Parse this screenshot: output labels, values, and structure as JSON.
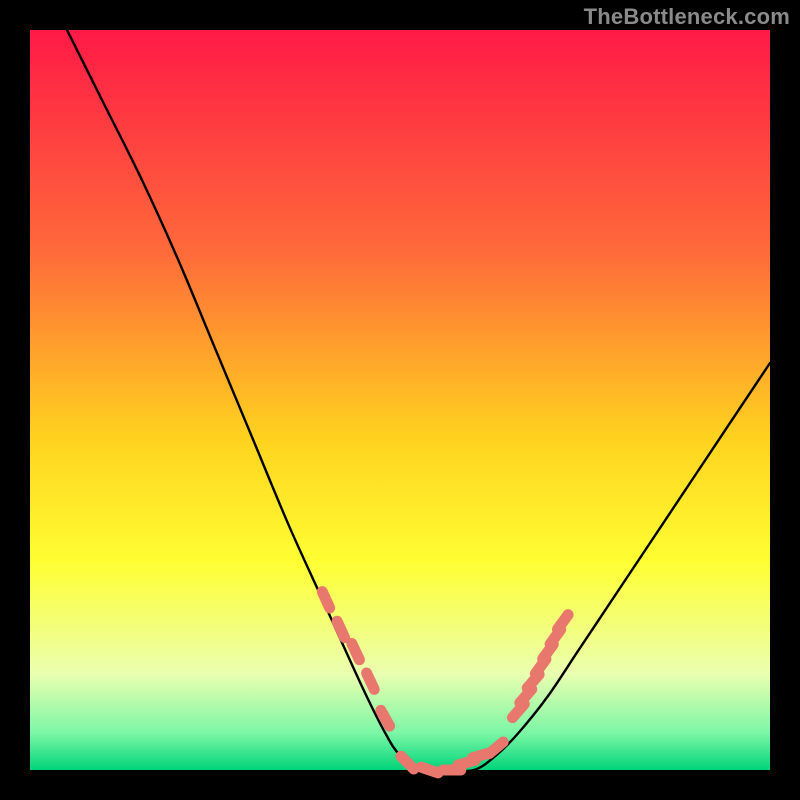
{
  "watermark": "TheBottleneck.com",
  "colors": {
    "frame": "#000000",
    "grad_top": "#ff1a46",
    "grad_mid1": "#ff6a3a",
    "grad_mid2": "#ffd21f",
    "grad_mid3": "#ffff33",
    "grad_mid4": "#eaffb0",
    "grad_bottom1": "#7cf7a6",
    "grad_bottom2": "#00d47a",
    "curve": "#000000",
    "marker": "#e8776e"
  },
  "chart_data": {
    "type": "line",
    "title": "",
    "xlabel": "",
    "ylabel": "",
    "xlim": [
      0,
      100
    ],
    "ylim": [
      0,
      100
    ],
    "grid": false,
    "legend": false,
    "series": [
      {
        "name": "bottleneck-curve",
        "x": [
          5,
          10,
          15,
          20,
          25,
          30,
          35,
          40,
          45,
          48,
          50,
          53,
          56,
          60,
          63,
          66,
          70,
          74,
          78,
          82,
          86,
          90,
          94,
          98,
          100
        ],
        "y": [
          100,
          90,
          80,
          69,
          57,
          45,
          33,
          22,
          11,
          5,
          2,
          0,
          0,
          0,
          2,
          5,
          10,
          16,
          22,
          28,
          34,
          40,
          46,
          52,
          55
        ]
      }
    ],
    "markers": [
      {
        "name": "left-cluster",
        "x": [
          40,
          42,
          44,
          46,
          48
        ],
        "y": [
          23,
          19,
          16,
          12,
          7
        ]
      },
      {
        "name": "floor-cluster",
        "x": [
          51,
          54,
          57,
          59,
          61,
          63
        ],
        "y": [
          1,
          0,
          0,
          1,
          2,
          3
        ]
      },
      {
        "name": "right-cluster",
        "x": [
          66,
          67,
          68,
          69,
          70,
          71,
          72
        ],
        "y": [
          8,
          10,
          12,
          14,
          16,
          18,
          20
        ]
      }
    ]
  }
}
